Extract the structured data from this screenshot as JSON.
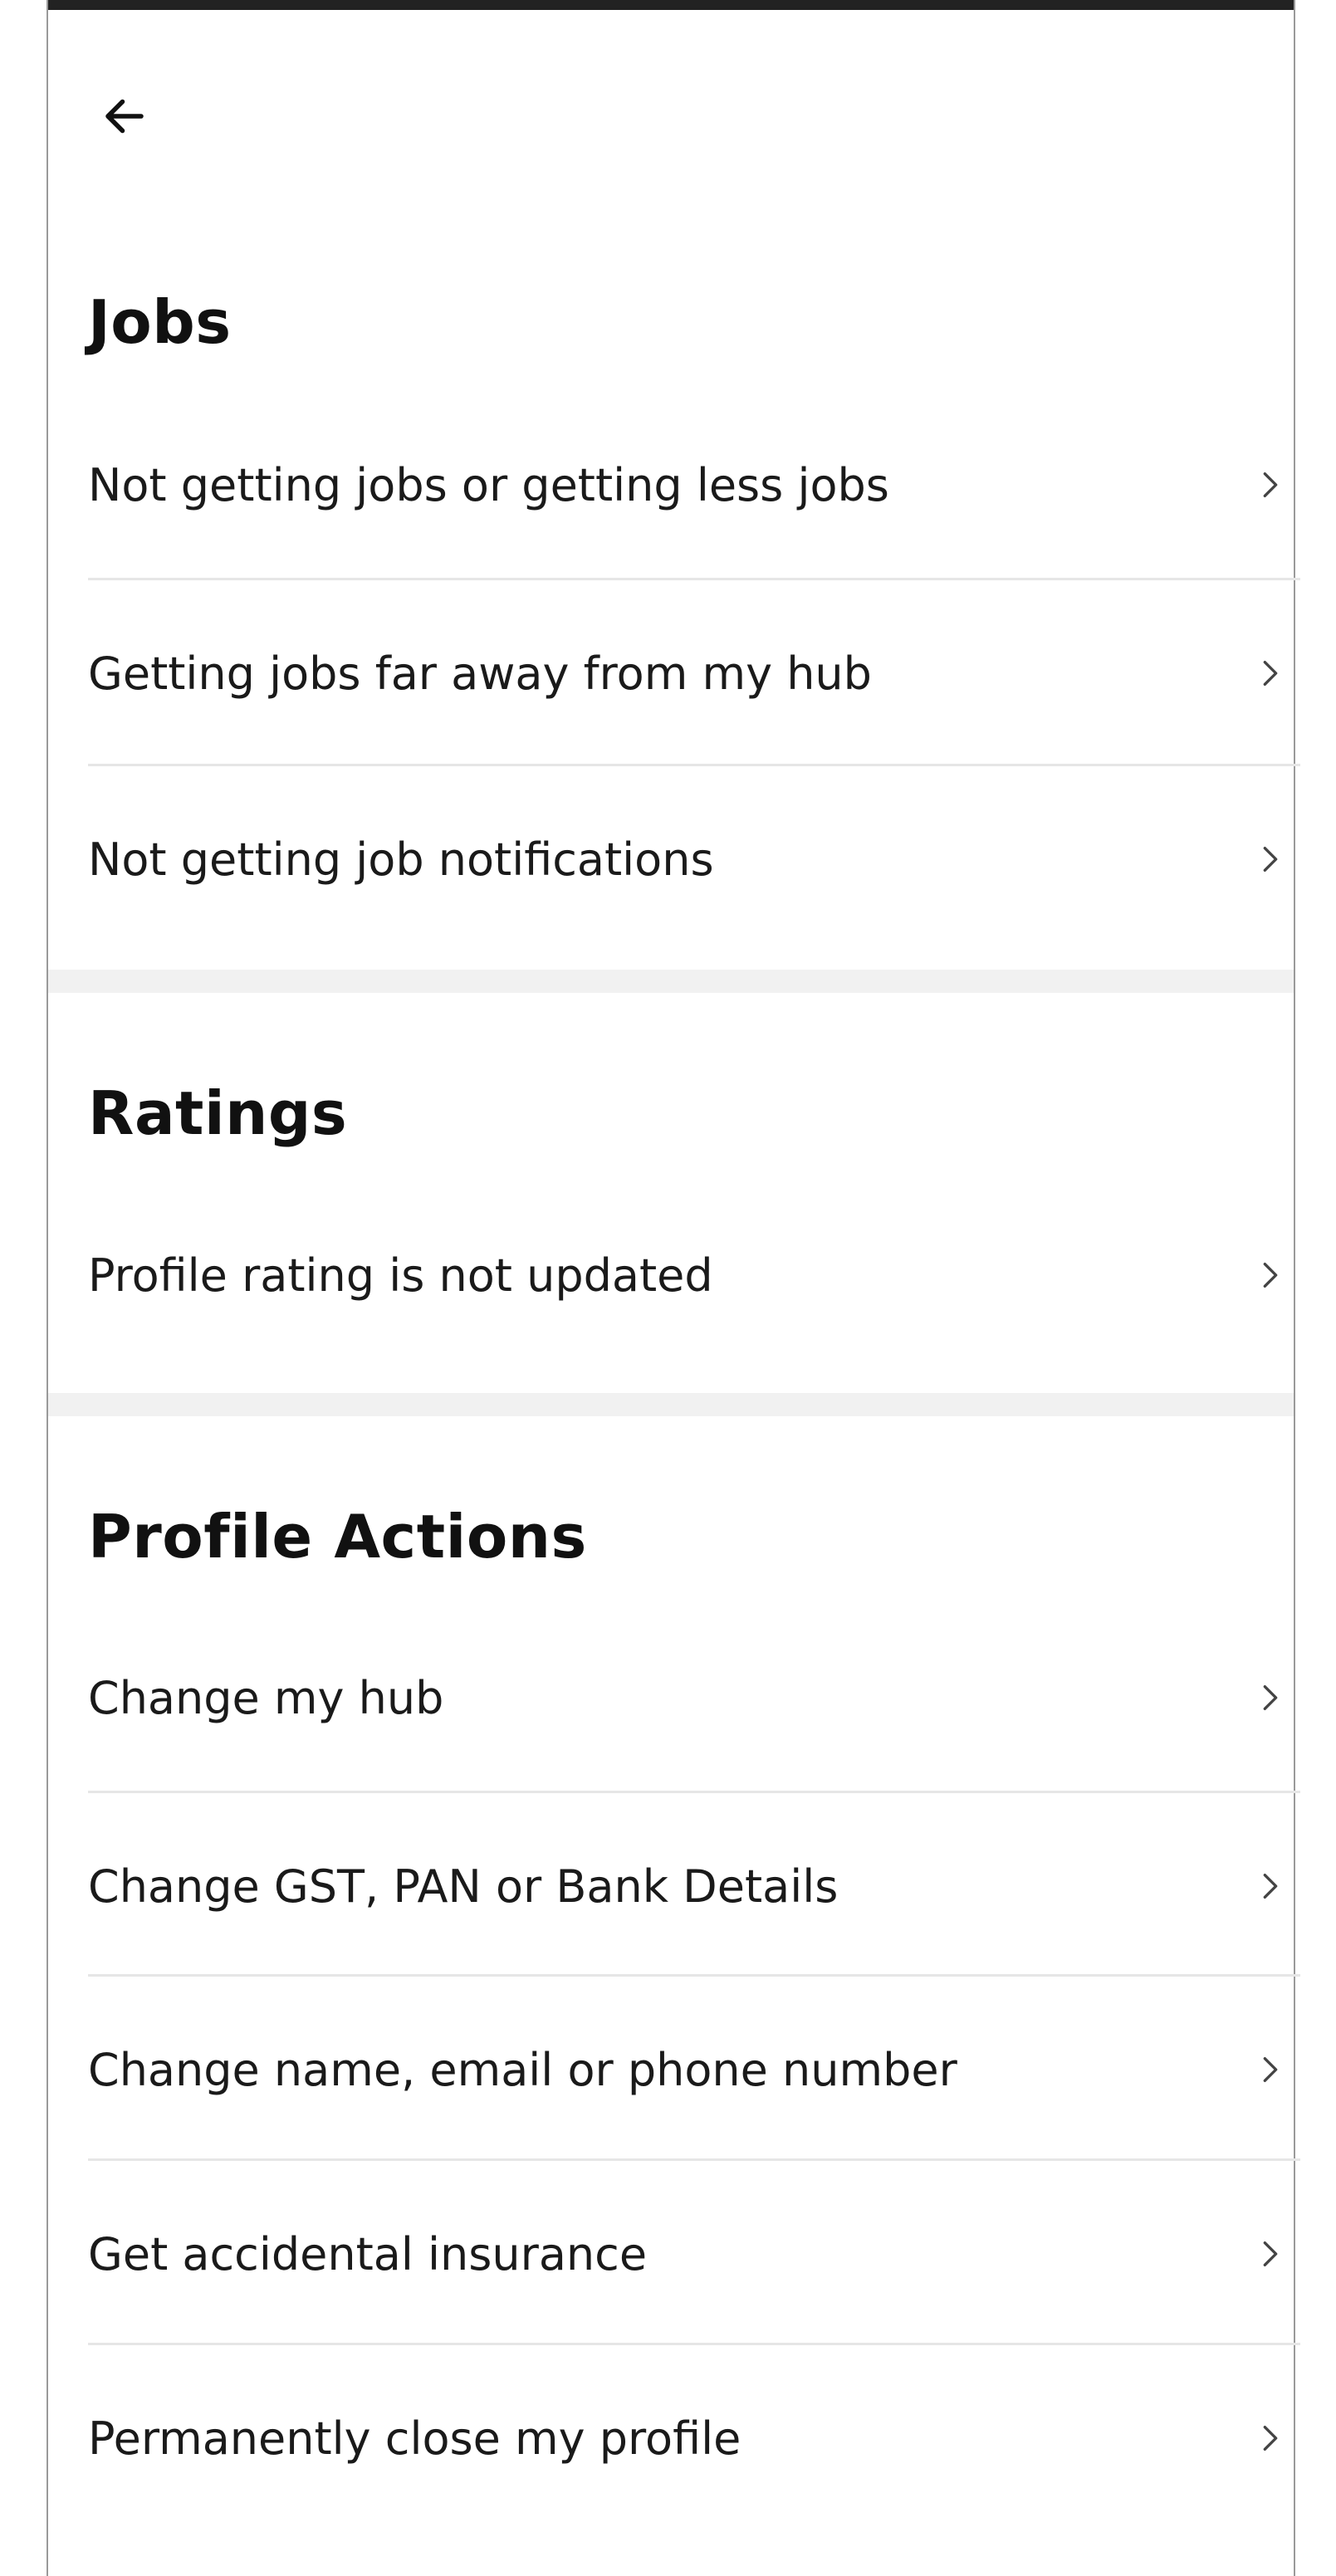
{
  "header": {
    "back_icon": "arrow-left-icon"
  },
  "sections": {
    "jobs": {
      "title": "Jobs",
      "items": [
        {
          "label": "Not getting jobs or getting less jobs",
          "icon": "chevron-right-icon"
        },
        {
          "label": "Getting jobs far away from my hub",
          "icon": "chevron-right-icon"
        },
        {
          "label": "Not getting job notifications",
          "icon": "chevron-right-icon"
        }
      ]
    },
    "ratings": {
      "title": "Ratings",
      "items": [
        {
          "label": "Profile rating is not updated",
          "icon": "chevron-right-icon"
        }
      ]
    },
    "profile_actions": {
      "title": "Profile Actions",
      "items": [
        {
          "label": "Change my hub",
          "icon": "chevron-right-icon"
        },
        {
          "label": "Change GST, PAN or Bank Details",
          "icon": "chevron-right-icon"
        },
        {
          "label": "Change name, email or phone number",
          "icon": "chevron-right-icon"
        },
        {
          "label": "Get accidental insurance",
          "icon": "chevron-right-icon"
        },
        {
          "label": "Permanently close my profile",
          "icon": "chevron-right-icon"
        }
      ]
    }
  },
  "colors": {
    "text": "#111111",
    "divider": "#e6e6e6",
    "section_gap": "#f1f1f1",
    "chevron": "#444444"
  }
}
